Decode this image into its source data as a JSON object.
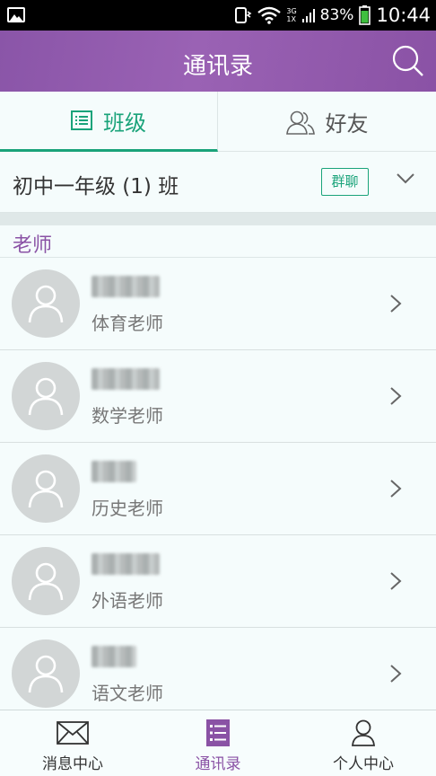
{
  "status_bar": {
    "network": "3G",
    "network_sub": "1X",
    "battery": "83%",
    "time": "10:44"
  },
  "header": {
    "title": "通讯录"
  },
  "tabs": [
    {
      "label": "班级",
      "active": true
    },
    {
      "label": "好友",
      "active": false
    }
  ],
  "class_selector": {
    "class_name": "初中一年级 (1) 班",
    "group_chat_label": "群聊"
  },
  "section": {
    "title": "老师"
  },
  "contacts": [
    {
      "role": "体育老师"
    },
    {
      "role": "数学老师"
    },
    {
      "role": "历史老师"
    },
    {
      "role": "外语老师"
    },
    {
      "role": "语文老师"
    }
  ],
  "bottom_nav": [
    {
      "label": "消息中心",
      "icon": "mail-icon"
    },
    {
      "label": "通讯录",
      "icon": "contacts-list-icon",
      "active": true
    },
    {
      "label": "个人中心",
      "icon": "person-icon"
    }
  ],
  "colors": {
    "brand_purple": "#8a52a5",
    "accent_green": "#1aa37a"
  }
}
